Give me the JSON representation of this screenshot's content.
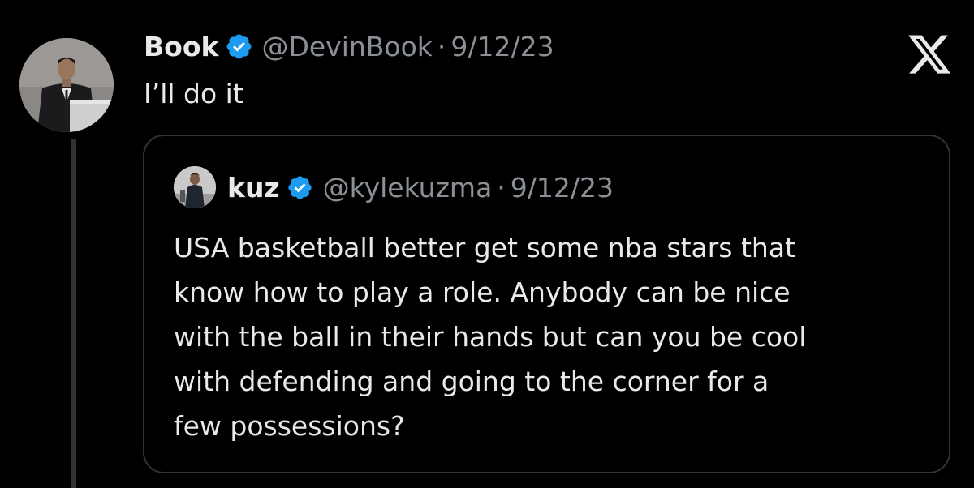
{
  "tweet": {
    "author_name": "Book",
    "verified_icon": "verified-badge-icon",
    "handle": "@DevinBook",
    "separator": "·",
    "date": "9/12/23",
    "text": "I’ll do it"
  },
  "brand": {
    "logo_icon": "x-logo-icon",
    "accent_color": "#1d9bf0",
    "background": "#000000"
  },
  "quoted_tweet": {
    "author_name": "kuz",
    "verified_icon": "verified-badge-icon",
    "handle": "@kylekuzma",
    "separator": "·",
    "date": "9/12/23",
    "text_lines": [
      "USA basketball better get some nba stars that",
      "know how to play a role. Anybody can be nice",
      "with the ball in their hands but can you be cool",
      "with defending and going to the corner for a",
      "few possessions?"
    ]
  }
}
